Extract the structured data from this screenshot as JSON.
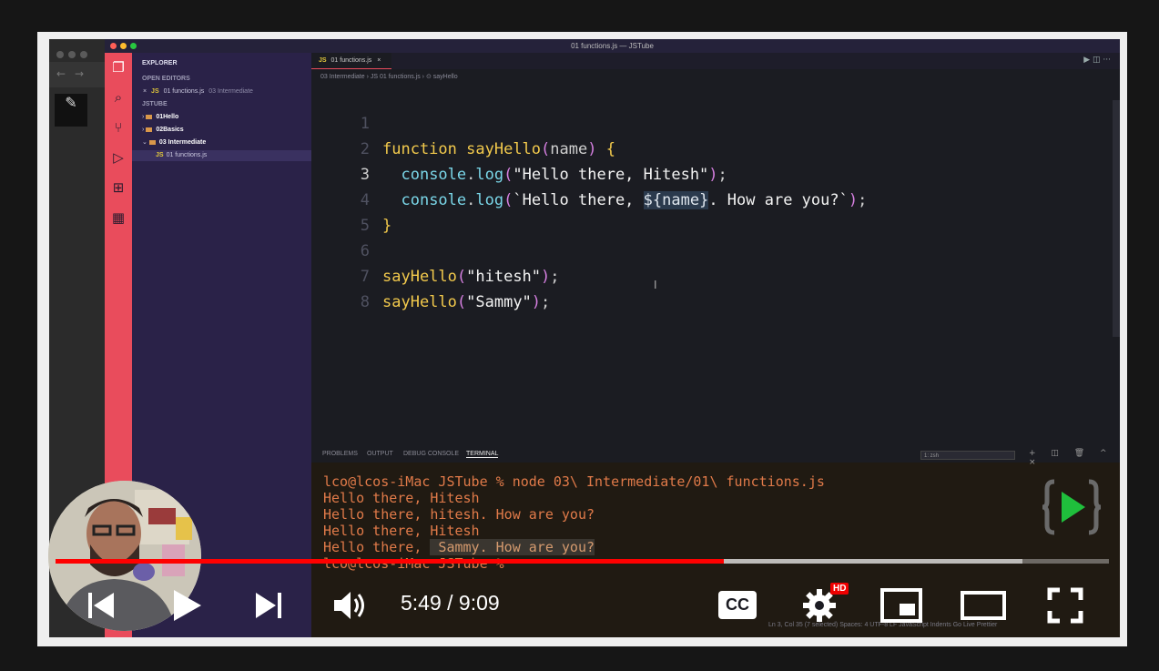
{
  "window": {
    "title": "01 functions.js — JSTube"
  },
  "activity_bar": {
    "icons": [
      "files-icon",
      "search-icon",
      "source-control-icon",
      "debug-icon",
      "extensions-icon",
      "docker-icon"
    ]
  },
  "explorer": {
    "header": "EXPLORER",
    "open_editors_label": "OPEN EDITORS",
    "open_editor_item": {
      "close": "×",
      "badge": "JS",
      "name": "01 functions.js",
      "folder": "03 Intermediate"
    },
    "project_label": "JSTUBE",
    "tree": [
      {
        "name": "01Hello",
        "chevron": "›"
      },
      {
        "name": "02Basics",
        "chevron": "›"
      },
      {
        "name": "03 Intermediate",
        "chevron": "⌄"
      }
    ],
    "open_file": {
      "badge": "JS",
      "name": "01 functions.js"
    }
  },
  "editor": {
    "tab": {
      "badge": "JS",
      "name": "01 functions.js",
      "close": "×"
    },
    "breadcrumb": "03 Intermediate  ›  JS  01 functions.js  ›  ⊙ sayHello",
    "tab_icons": "▶  ◫  ···",
    "code": {
      "l1_kw": "function",
      "l1_fn": "sayHello",
      "l1_paren_open": "(",
      "l1_param": "name",
      "l1_paren_close": ")",
      "l1_brace": "{",
      "l2_obj": "console",
      "l2_dot": ".",
      "l2_method": "log",
      "l2_open": "(",
      "l2_str": "\"Hello there, Hitesh\"",
      "l2_close": ")",
      "l2_semi": ";",
      "l3_obj": "console",
      "l3_dot": ".",
      "l3_method": "log",
      "l3_open": "(",
      "l3_str_a": "`Hello there, ",
      "l3_tmpl": "${name}",
      "l3_str_b": ". How are you?`",
      "l3_close": ")",
      "l3_semi": ";",
      "l4_brace": "}",
      "l6_fn": "sayHello",
      "l6_open": "(",
      "l6_str": "\"hitesh\"",
      "l6_close": ")",
      "l6_semi": ";",
      "l7_fn": "sayHello",
      "l7_open": "(",
      "l7_str": "\"Sammy\"",
      "l7_close": ")",
      "l7_semi": ";"
    },
    "line_numbers": [
      "1",
      "2",
      "3",
      "4",
      "5",
      "6",
      "7",
      "8"
    ]
  },
  "panel": {
    "tabs": [
      "PROBLEMS",
      "OUTPUT",
      "DEBUG CONSOLE",
      "TERMINAL"
    ],
    "shell": "1: zsh",
    "icons": "+ ◫ 🗑 ^ ×",
    "terminal_lines": [
      "lco@lcos-iMac JSTube % node 03\\ Intermediate/01\\ functions.js",
      "Hello there, Hitesh",
      "Hello there, hitesh. How are you?",
      "Hello there, Hitesh",
      "Hello there, ",
      "lco@lcos-iMac JSTube % "
    ],
    "terminal_highlight": " Sammy. How are you?"
  },
  "status_bar": "Ln 3, Col 35 (7 selected)   Spaces: 4   UTF-8   LF   JavaScript   Indents   Go Live   Prettier",
  "player": {
    "time": "5:49 / 9:09",
    "hd_badge": "HD",
    "cc_label": "CC",
    "progress_fraction": 0.634,
    "buffered_fraction": 0.918,
    "progress_color": "#ff0000"
  },
  "colors": {
    "activity_bar": "#e94c5c",
    "sidebar": "#2a2248",
    "editor": "#1b1c22",
    "terminal_text": "#e07a49",
    "brand_green": "#1fbf3c"
  }
}
